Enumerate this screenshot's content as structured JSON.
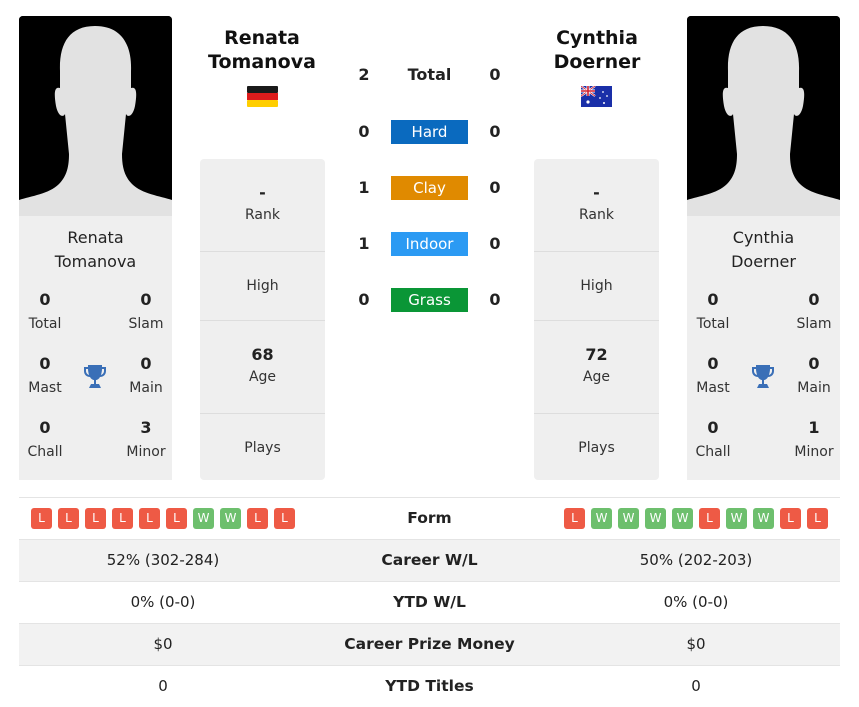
{
  "players": [
    {
      "name": "Renata Tomanova",
      "name_line1": "Renata",
      "name_line2": "Tomanova",
      "flag": "germany-flag",
      "rank": "-",
      "rank_label": "Rank",
      "high": "",
      "high_label": "High",
      "age": "68",
      "age_label": "Age",
      "plays": "",
      "plays_label": "Plays",
      "titles": {
        "total": "0",
        "total_label": "Total",
        "slam": "0",
        "slam_label": "Slam",
        "mast": "0",
        "mast_label": "Mast",
        "main": "0",
        "main_label": "Main",
        "chall": "0",
        "chall_label": "Chall",
        "minor": "3",
        "minor_label": "Minor"
      },
      "form": [
        "L",
        "L",
        "L",
        "L",
        "L",
        "L",
        "W",
        "W",
        "L",
        "L"
      ],
      "career_wl": "52% (302-284)",
      "ytd_wl": "0% (0-0)",
      "prize_money": "$0",
      "ytd_titles": "0"
    },
    {
      "name": "Cynthia Doerner",
      "name_line1": "Cynthia",
      "name_line2": "Doerner",
      "flag": "australia-flag",
      "rank": "-",
      "rank_label": "Rank",
      "high": "",
      "high_label": "High",
      "age": "72",
      "age_label": "Age",
      "plays": "",
      "plays_label": "Plays",
      "titles": {
        "total": "0",
        "total_label": "Total",
        "slam": "0",
        "slam_label": "Slam",
        "mast": "0",
        "mast_label": "Mast",
        "main": "0",
        "main_label": "Main",
        "chall": "0",
        "chall_label": "Chall",
        "minor": "1",
        "minor_label": "Minor"
      },
      "form": [
        "L",
        "W",
        "W",
        "W",
        "W",
        "L",
        "W",
        "W",
        "L",
        "L"
      ],
      "career_wl": "50% (202-203)",
      "ytd_wl": "0% (0-0)",
      "prize_money": "$0",
      "ytd_titles": "0"
    }
  ],
  "h2h": [
    {
      "label": "Total",
      "left": "2",
      "right": "0",
      "color": ""
    },
    {
      "label": "Hard",
      "left": "0",
      "right": "0",
      "color": "#0a6abf"
    },
    {
      "label": "Clay",
      "left": "1",
      "right": "0",
      "color": "#e08a00"
    },
    {
      "label": "Indoor",
      "left": "1",
      "right": "0",
      "color": "#2b9af3"
    },
    {
      "label": "Grass",
      "left": "0",
      "right": "0",
      "color": "#0a9636"
    }
  ],
  "table": {
    "form_label": "Form",
    "career_wl_label": "Career W/L",
    "ytd_wl_label": "YTD W/L",
    "prize_label": "Career Prize Money",
    "ytd_titles_label": "YTD Titles"
  },
  "colors": {
    "win": "#6dbf6d",
    "loss": "#ee5a45",
    "trophy": "#3a6fb7"
  }
}
